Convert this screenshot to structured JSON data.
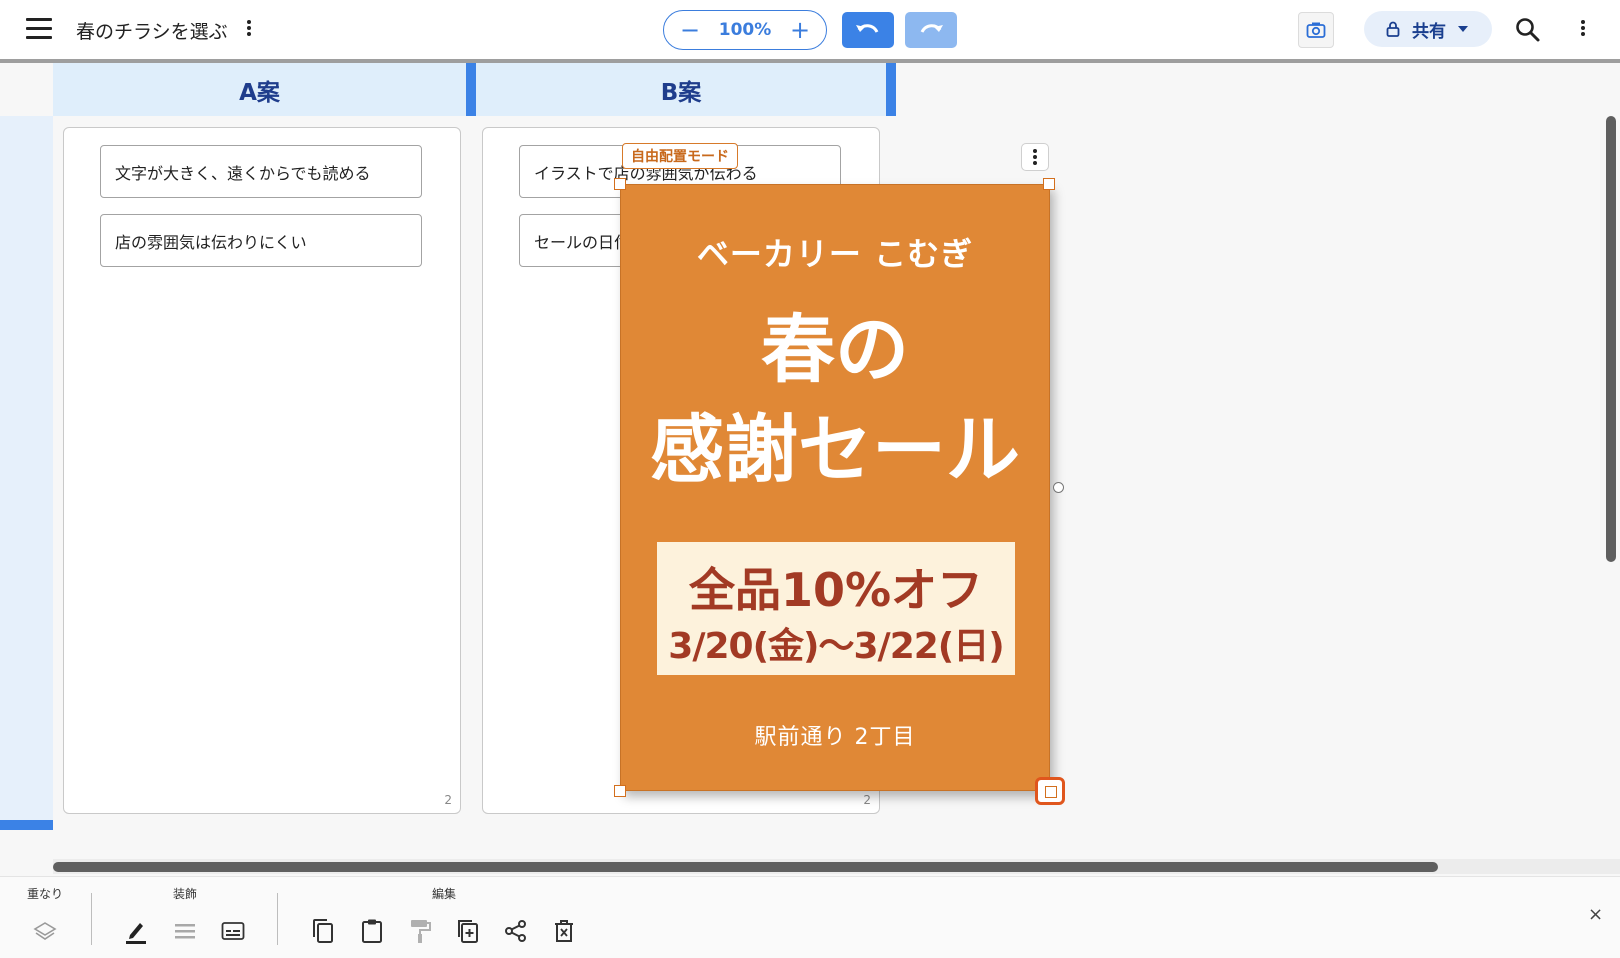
{
  "header": {
    "menu_icon": "hamburger-menu-icon",
    "title": "春のチラシを選ぶ",
    "zoom": {
      "minus": "−",
      "value": "100%",
      "plus": "+"
    },
    "share_label": "共有"
  },
  "board": {
    "columns": [
      {
        "header": "A案",
        "count": "2",
        "cards": [
          "文字が大きく、遠くからでも読める",
          "店の雰囲気は伝わりにくい"
        ]
      },
      {
        "header": "B案",
        "count": "2",
        "cards": [
          "イラストで店の雰囲気が伝わる",
          "セールの日付"
        ]
      }
    ]
  },
  "poster": {
    "mode_tag": "自由配置モード",
    "shop_name": "ベーカリー こむぎ",
    "headline_1": "春の",
    "headline_2": "感謝セール",
    "offer": "全品10%オフ",
    "dates": "3/20(金)〜3/22(日)",
    "address": "駅前通り 2丁目",
    "background_color": "#e08836",
    "box_color": "#fdf2dc",
    "box_text_color": "#a23a24"
  },
  "toolbar": {
    "groups": {
      "layer": "重なり",
      "decoration": "装飾",
      "edit": "編集"
    },
    "close": "×"
  },
  "colors": {
    "accent": "#3b82e6",
    "selection": "#e0561d"
  }
}
